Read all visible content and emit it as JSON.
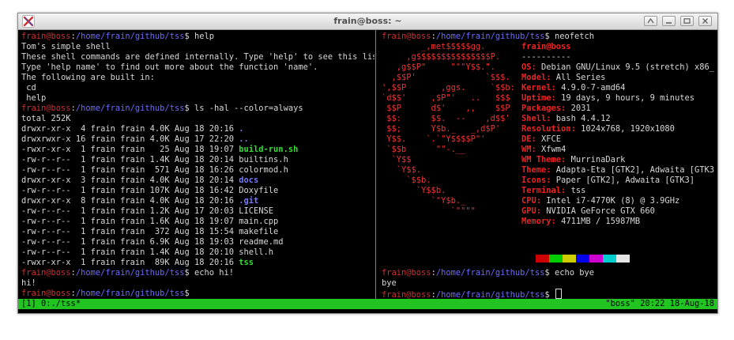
{
  "window": {
    "title": "frain@boss: ~",
    "buttons": [
      "shade-icon",
      "minimize-icon",
      "maximize-icon",
      "close-icon"
    ]
  },
  "prompt": {
    "user_host": "frain@boss",
    "sep": ":",
    "path": "/home/frain/github/tss",
    "dollar": "$ "
  },
  "left_pane": {
    "cmd_help": "help",
    "help_output": [
      "Tom's simple shell",
      "These shell commands are defined internally. Type 'help' to see this list.",
      "Type 'help name' to find out more about the function 'name'.",
      "The following are built in:",
      " cd",
      " help"
    ],
    "cmd_ls": "ls -hal --color=always",
    "ls_total": "total 252K",
    "ls_rows": [
      {
        "meta": "drwxr-xr-x  4 frain frain 4.0K Aug 18 20:16 ",
        "name": ".",
        "kind": "dir"
      },
      {
        "meta": "drwxrwxr-x 16 frain frain 4.0K Aug 17 22:20 ",
        "name": "..",
        "kind": "dir"
      },
      {
        "meta": "-rwxr-xr-x  1 frain frain   25 Aug 18 19:07 ",
        "name": "build-run.sh",
        "kind": "exe"
      },
      {
        "meta": "-rw-r--r--  1 frain frain 1.4K Aug 18 20:14 ",
        "name": "builtins.h",
        "kind": "file"
      },
      {
        "meta": "-rw-r--r--  1 frain frain  571 Aug 18 16:26 ",
        "name": "colormod.h",
        "kind": "file"
      },
      {
        "meta": "drwxr-xr-x  3 frain frain 4.0K Aug 18 20:14 ",
        "name": "docs",
        "kind": "dir"
      },
      {
        "meta": "-rw-r--r--  1 frain frain 107K Aug 18 16:42 ",
        "name": "Doxyfile",
        "kind": "file"
      },
      {
        "meta": "drwxr-xr-x  8 frain frain 4.0K Aug 18 20:16 ",
        "name": ".git",
        "kind": "dir"
      },
      {
        "meta": "-rw-r--r--  1 frain frain 1.2K Aug 17 20:03 ",
        "name": "LICENSE",
        "kind": "file"
      },
      {
        "meta": "-rw-r--r--  1 frain frain 1.6K Aug 18 19:07 ",
        "name": "main.cpp",
        "kind": "file"
      },
      {
        "meta": "-rw-r--r--  1 frain frain  372 Aug 18 15:54 ",
        "name": "makefile",
        "kind": "file"
      },
      {
        "meta": "-rw-r--r--  1 frain frain 6.9K Aug 18 19:03 ",
        "name": "readme.md",
        "kind": "file"
      },
      {
        "meta": "-rw-r--r--  1 frain frain 1.4K Aug 18 20:10 ",
        "name": "shell.h",
        "kind": "file"
      },
      {
        "meta": "-rwxr-xr-x  1 frain frain  89K Aug 18 20:16 ",
        "name": "tss",
        "kind": "exe"
      }
    ],
    "cmd_echo": "echo hi!",
    "echo_output": "hi!"
  },
  "right_pane": {
    "cmd_neofetch": "neofetch",
    "logo": [
      "        _,met$$$$$gg.",
      "     ,g$$$$$$$$$$$$$$$P.",
      "   ,g$$P\"     \"\"\"Y$$.\".",
      "  ,$$P'              `$$$.",
      "',$$P       ,ggs.     `$$b:",
      "`d$$'     ,$P\"'   .    $$$",
      " $$P      d$'     ,    $$P",
      " $$:      $$.   -    ,d$$'",
      " $$;      Y$b._   _,d$P'",
      " Y$$.    `.`\"Y$$$$P\"'",
      " `$$b      \"-.__",
      "  `Y$$",
      "   `Y$$.",
      "     `$$b.",
      "       `Y$$b.",
      "          `\"Y$b._",
      "              `\"\"\"\""
    ],
    "logo_red_marks": [
      {
        "line": 5,
        "col": 19,
        "text": "."
      },
      {
        "line": 6,
        "col": 17,
        "text": ","
      },
      {
        "line": 7,
        "col": 15,
        "text": "-"
      },
      {
        "line": 9,
        "col": 9,
        "text": "`.`"
      },
      {
        "line": 10,
        "col": 12,
        "text": "\"-.__"
      }
    ],
    "user_title": "frain@boss",
    "separator": "----------",
    "info": [
      {
        "label": "OS",
        "value": "Debian GNU/Linux 9.5 (stretch) x86_"
      },
      {
        "label": "Model",
        "value": "All Series"
      },
      {
        "label": "Kernel",
        "value": "4.9.0-7-amd64"
      },
      {
        "label": "Uptime",
        "value": "19 days, 9 hours, 9 minutes"
      },
      {
        "label": "Packages",
        "value": "2031"
      },
      {
        "label": "Shell",
        "value": "bash 4.4.12"
      },
      {
        "label": "Resolution",
        "value": "1024x768, 1920x1080"
      },
      {
        "label": "DE",
        "value": "XFCE"
      },
      {
        "label": "WM",
        "value": "Xfwm4"
      },
      {
        "label": "WM Theme",
        "value": "MurrinaDark"
      },
      {
        "label": "Theme",
        "value": "Adapta-Eta [GTK2], Adwaita [GTK3"
      },
      {
        "label": "Icons",
        "value": "Paper [GTK2], Adwaita [GTK3]"
      },
      {
        "label": "Terminal",
        "value": "tss"
      },
      {
        "label": "CPU",
        "value": "Intel i7-4770K (8) @ 3.9GHz"
      },
      {
        "label": "GPU",
        "value": "NVIDIA GeForce GTX 660"
      },
      {
        "label": "Memory",
        "value": "4711MB / 15987MB"
      }
    ],
    "colors": [
      "#cd0000",
      "#00cd00",
      "#cdcd00",
      "#0000ee",
      "#cd00cd",
      "#00cdcd",
      "#e5e5e5"
    ],
    "cmd_echo": "echo bye",
    "echo_output": "bye"
  },
  "tmux": {
    "left": "[1] 0:./tss*",
    "right": "\"boss\" 20:22 18-Aug-18",
    "bar_color": "#22c422"
  }
}
